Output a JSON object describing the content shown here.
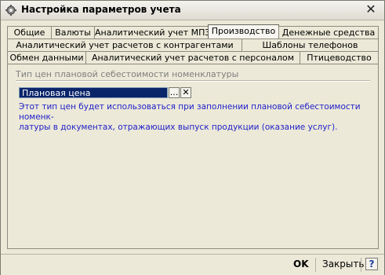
{
  "window": {
    "title": "Настройка параметров учета",
    "close_glyph": "✕"
  },
  "tabs": {
    "row1": [
      "Общие",
      "Валюты",
      "Аналитический учет МПЗ",
      "Производство",
      "Денежные средства"
    ],
    "row2": [
      "Аналитический учет расчетов с контрагентами",
      "Шаблоны телефонов"
    ],
    "row3": [
      "Обмен данными",
      "Аналитический учет расчетов с персоналом",
      "Птицеводство"
    ],
    "active": "Производство"
  },
  "panel": {
    "group_title": "Тип цен плановой себестоимости номенклатуры",
    "field_value": "Плановая цена",
    "select_button": "...",
    "clear_button": "✕",
    "hint_line1": "Этот тип цен будет использоваться при заполнении плановой себестоимости номенк-",
    "hint_line2": "латуры в документах, отражающих выпуск продукции (оказание услуг)."
  },
  "footer": {
    "ok": "OK",
    "close": "Закрыть",
    "help": "?"
  },
  "icons": {
    "title_icon": "gear-icon"
  }
}
